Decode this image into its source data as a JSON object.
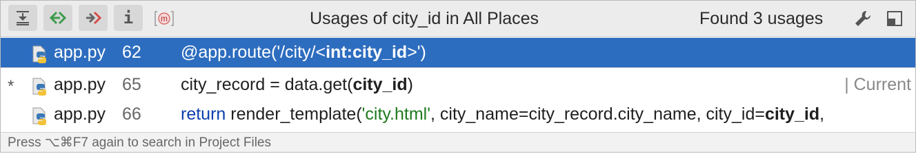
{
  "toolbar": {
    "expand_all_icon": "expand-all-icon",
    "previous_icon": "previous-occurrence-icon",
    "next_icon": "next-occurrence-icon",
    "info_icon": "info-icon",
    "info_label": "i",
    "member_icon_label": "m"
  },
  "header": {
    "title": "Usages of city_id in All Places",
    "found": "Found 3 usages"
  },
  "colors": {
    "selection": "#2d6dbf",
    "keyword": "#0b3fad",
    "string": "#1d7a1d",
    "prev_green": "#3e9b4b",
    "next_red": "#d64b4b"
  },
  "rows": [
    {
      "file": "app.py",
      "line": "62",
      "code": [
        "@app.route('/city/<",
        "int:city_id",
        ">')"
      ],
      "selected": true
    },
    {
      "marker": "*",
      "file": "app.py",
      "line": "65",
      "code": [
        "city_record = data.get(",
        "city_id",
        ")"
      ],
      "note": "| Current"
    },
    {
      "file": "app.py",
      "line": "66",
      "code": [
        "return",
        " render_template(",
        "'city.html'",
        ", city_name=city_record.city_name, city_id=",
        "city_id",
        ","
      ]
    }
  ],
  "status": "Press ⌥⌘F7 again to search in Project Files"
}
